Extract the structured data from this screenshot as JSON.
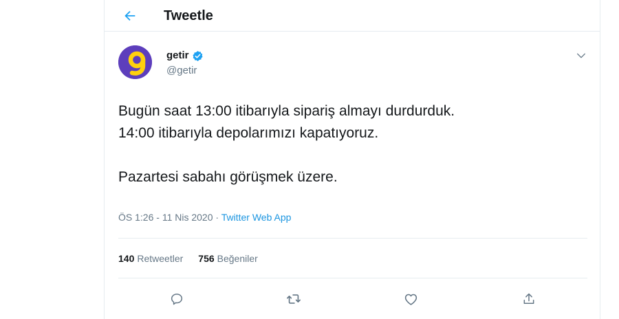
{
  "header": {
    "title": "Tweetle",
    "back_icon": "arrow-left-icon",
    "accent_color": "#1da1f2"
  },
  "tweet": {
    "user_name": "getir",
    "handle": "@getir",
    "avatar_icon": "getir-logo-avatar",
    "verified_icon": "verified-badge-icon",
    "menu_icon": "chevron-down-icon",
    "text_lines": [
      "Bugün saat 13:00 itibarıyla sipariş almayı durdurduk.",
      "14:00 itibarıyla depolarımızı kapatıyoruz.",
      "",
      "Pazartesi sabahı görüşmek üzere."
    ],
    "time": "ÖS 1:26",
    "separator": "·",
    "date": "11 Nis 2020",
    "source": "Twitter Web App"
  },
  "stats": {
    "retweets_count": "140",
    "retweets_label": "Retweetler",
    "likes_count": "756",
    "likes_label": "Beğeniler"
  },
  "actions": [
    {
      "icon": "reply-icon"
    },
    {
      "icon": "retweet-icon"
    },
    {
      "icon": "like-heart-icon"
    },
    {
      "icon": "share-icon"
    }
  ],
  "colors": {
    "brand_purple": "#5d3ebc",
    "brand_yellow": "#ffd10d",
    "link_blue": "#1b95e0",
    "muted_gray": "#657786"
  }
}
